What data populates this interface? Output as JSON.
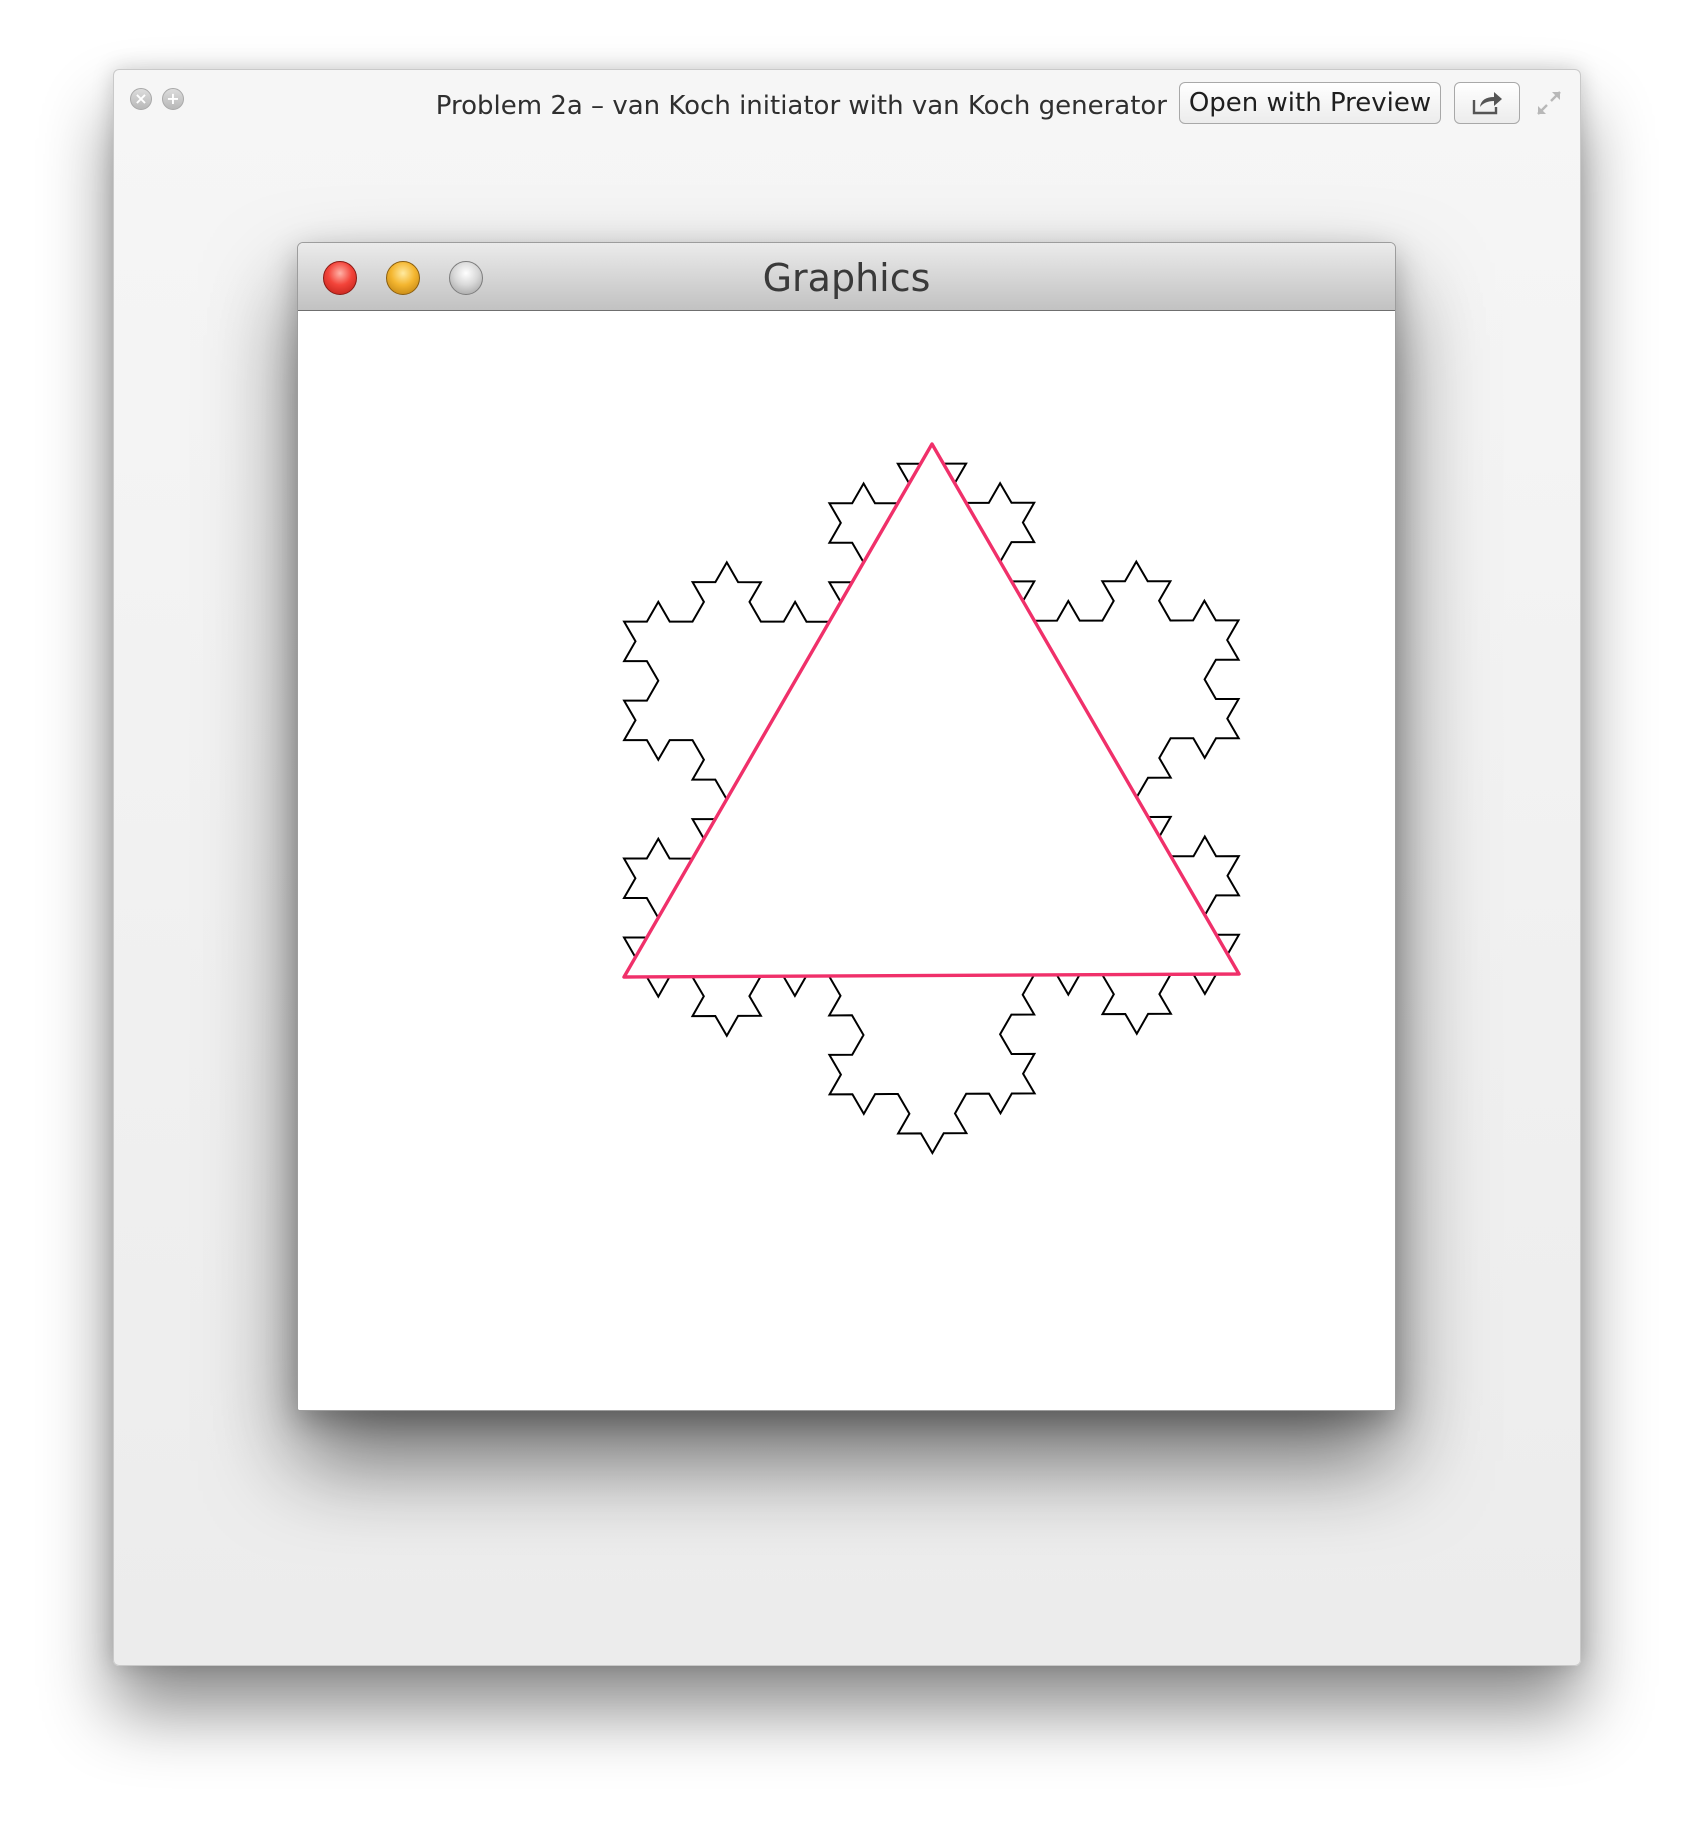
{
  "quicklook": {
    "title": "Problem 2a – van Koch initiator with van Koch generator",
    "open_button": "Open with Preview",
    "close_icon": "close-icon",
    "add_icon": "plus-icon",
    "share_icon": "share-icon",
    "fullscreen_icon": "expand-icon"
  },
  "graphics_window": {
    "title": "Graphics",
    "fractal_color": "#000000",
    "triangle_color": "#f0306a",
    "koch_iterations": 3
  }
}
